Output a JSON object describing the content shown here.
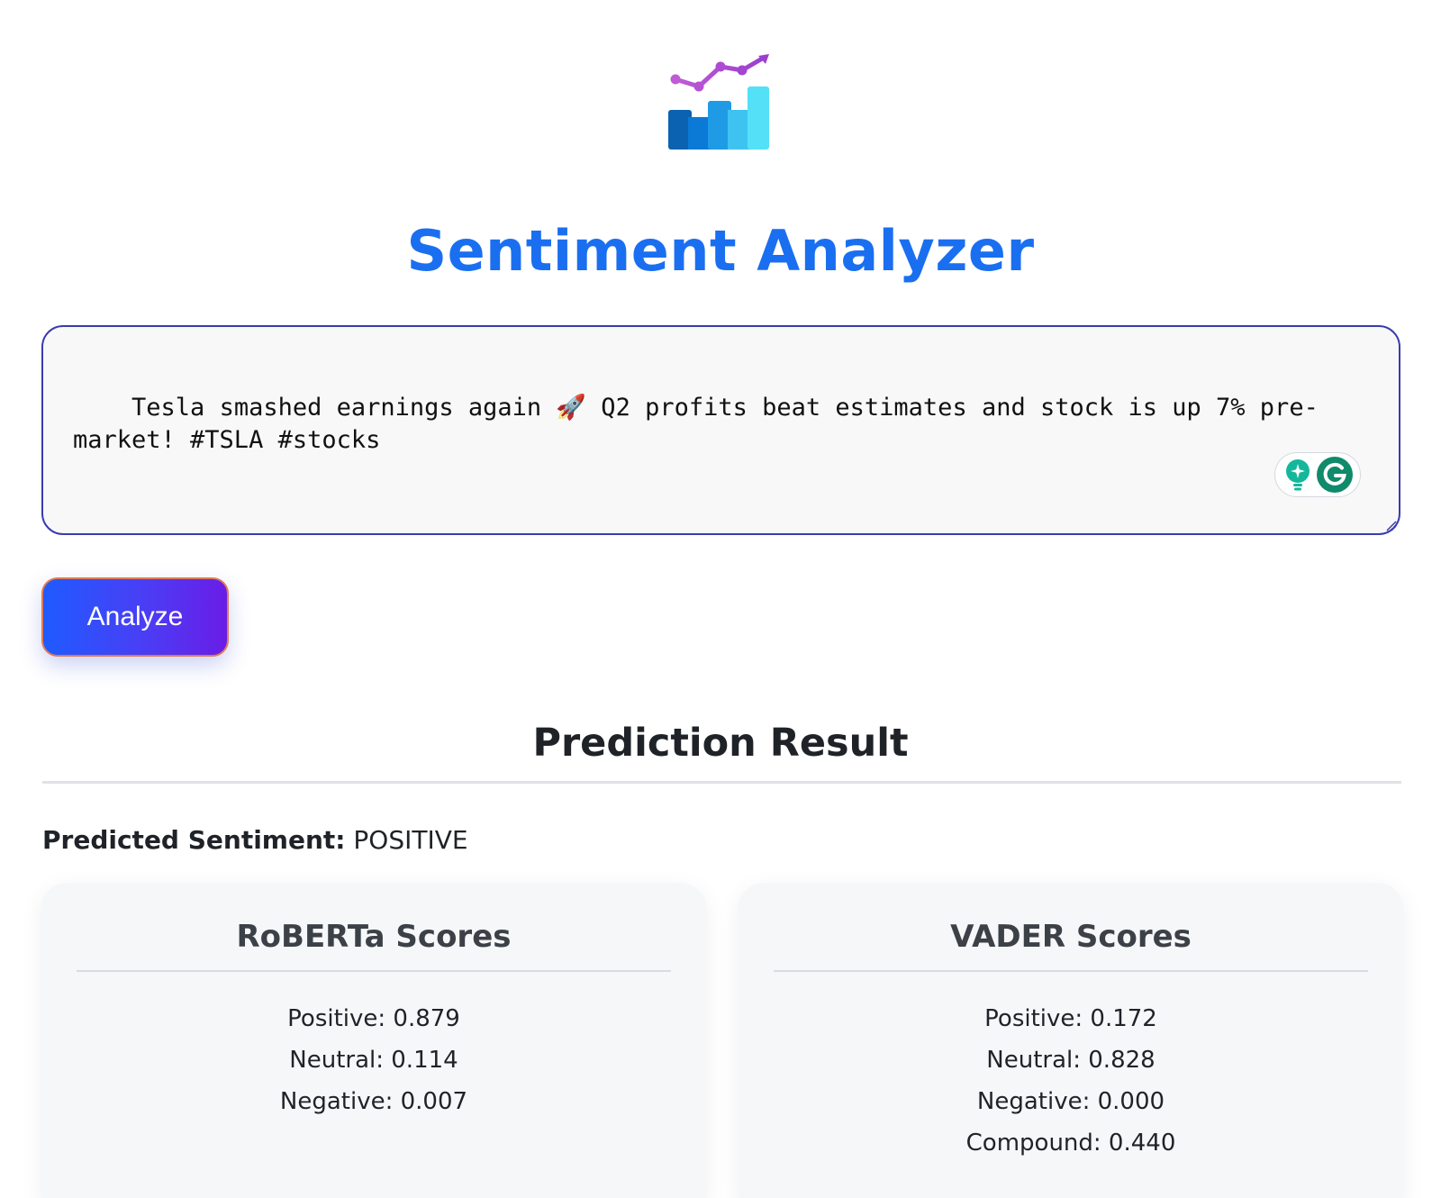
{
  "app": {
    "title": "Sentiment Analyzer",
    "logo_icon": "chart-logo-icon"
  },
  "input": {
    "value": "Tesla smashed earnings again 🚀 Q2 profits beat estimates and stock is up 7% pre-market! #TSLA #stocks"
  },
  "actions": {
    "analyze_label": "Analyze"
  },
  "result": {
    "heading": "Prediction Result",
    "predicted_label": "Predicted Sentiment:",
    "predicted_value": "POSITIVE"
  },
  "roberta": {
    "title": "RoBERTa Scores",
    "scores": [
      "Positive: 0.879",
      "Neutral: 0.114",
      "Negative: 0.007"
    ]
  },
  "vader": {
    "title": "VADER Scores",
    "scores": [
      "Positive: 0.172",
      "Neutral: 0.828",
      "Negative: 0.000",
      "Compound: 0.440"
    ]
  },
  "colors": {
    "title": "#1a6ff0",
    "input_border": "#3a3cae",
    "button_start": "#1f5bff",
    "button_end": "#6a1de6"
  }
}
